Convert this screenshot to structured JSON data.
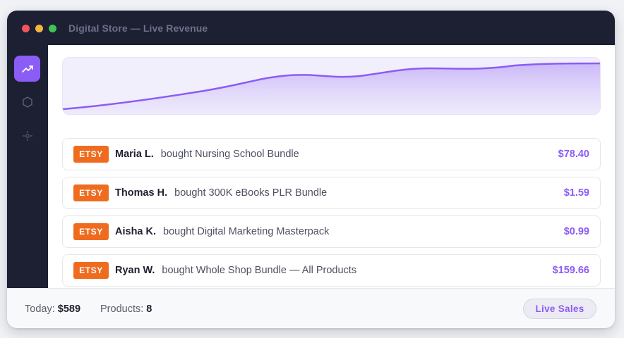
{
  "window": {
    "title": "Digital Store — Live Revenue",
    "controls": [
      "close",
      "minimize",
      "maximize"
    ]
  },
  "sidebar": {
    "items": [
      {
        "icon": "trending-up-icon",
        "active": true
      },
      {
        "icon": "hexagon-icon",
        "active": false
      },
      {
        "icon": "settings-icon",
        "active": false
      }
    ]
  },
  "revenue_chart": {
    "type": "area",
    "color": "#8b5cf6"
  },
  "sales": [
    {
      "store": "ETSY",
      "buyer": "Maria L.",
      "action": "bought Nursing School Bundle",
      "price": "$78.40"
    },
    {
      "store": "ETSY",
      "buyer": "Thomas H.",
      "action": "bought 300K eBooks PLR Bundle",
      "price": "$1.59"
    },
    {
      "store": "ETSY",
      "buyer": "Aisha K.",
      "action": "bought Digital Marketing Masterpack",
      "price": "$0.99"
    },
    {
      "store": "ETSY",
      "buyer": "Ryan W.",
      "action": "bought Whole Shop Bundle — All Products",
      "price": "$159.66"
    }
  ],
  "footer": {
    "today_label": "Today:",
    "today_value": "$589",
    "products_label": "Products:",
    "products_value": "8",
    "live_button": "Live Sales"
  },
  "colors": {
    "accent": "#8b5cf6",
    "etsy": "#ef6c1f",
    "titlebar": "#1d2033"
  }
}
